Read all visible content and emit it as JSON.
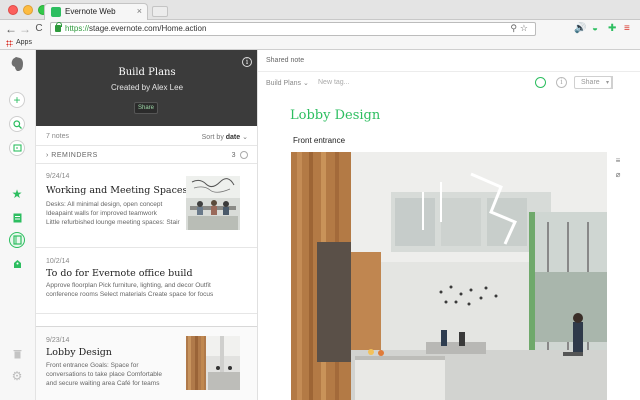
{
  "browser": {
    "tab_title": "Evernote Web",
    "tab_close": "×",
    "url_scheme": "https://",
    "url_rest": "stage.evernote.com/Home.action",
    "bookmarks_apps": "Apps",
    "nav_back": "←",
    "nav_forward": "→",
    "nav_reload": "C",
    "omni_icons": "⚲☆",
    "ext_icons": [
      "🔊",
      "◒",
      "✚",
      "≡"
    ]
  },
  "rail": {
    "items": [
      "elephant-icon",
      "new-note-icon",
      "search-icon",
      "work-chat-icon",
      "shortcuts-star-icon",
      "notes-icon",
      "notebooks-icon",
      "tags-icon",
      "trash-icon",
      "settings-gear-icon"
    ],
    "accent": "#2dbe60"
  },
  "notebook": {
    "title": "Build Plans",
    "created_by": "Created by Alex Lee",
    "share_label": "Share",
    "info_glyph": "i"
  },
  "list": {
    "count": "7 notes",
    "sort_prefix": "Sort by ",
    "sort_value": "date",
    "sort_caret": "⌄",
    "reminders_label": "›  REMINDERS",
    "reminders_count": "3",
    "notes": [
      {
        "date": "9/24/14",
        "title": "Working and Meeting Spaces",
        "snippet": [
          "Desks: All minimal design, open concept",
          "Ideapaint walls for improved teamwork",
          "Little refurbished lounge meeting spaces: Stair"
        ]
      },
      {
        "date": "10/2/14",
        "title": "To do for Evernote office build",
        "snippet": [
          "Approve floorplan Pick furniture, lighting, and decor Outfit",
          "conference rooms Select materials Create space for focus"
        ]
      },
      {
        "date": "9/23/14",
        "title": "Lobby Design",
        "snippet": [
          "Front entrance Goals: Space for",
          "conversations to take place Comfortable",
          "and secure waiting area Café for teams"
        ]
      }
    ]
  },
  "editor": {
    "shared_label": "Shared note",
    "notebook_label": "Build Plans ⌄",
    "tag_placeholder": "New tag...",
    "share_label": "Share",
    "share_caret": "▾",
    "info_glyph": "i",
    "note_title": "Lobby Design",
    "caption": "Front entrance",
    "side_tools": [
      "≡",
      "⌀"
    ]
  }
}
